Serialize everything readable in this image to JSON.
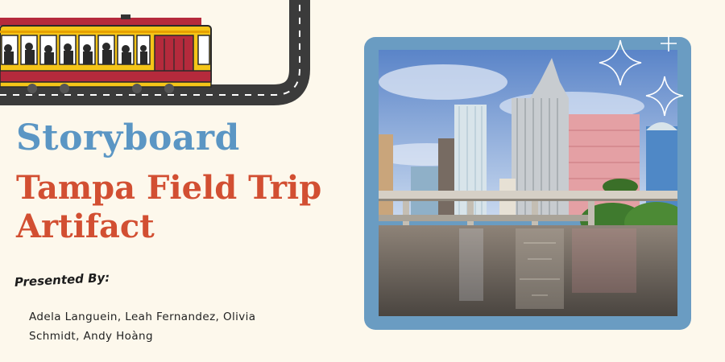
{
  "title_line1": "Storyboard",
  "title_line2": "Tampa Field Trip Artifact",
  "presented_label": "Presented By:",
  "authors": "Adela Languein, Leah Fernandez, Olivia Schmidt, Andy Hoàng",
  "colors": {
    "background": "#fdf8ec",
    "title_blue": "#5b96c4",
    "title_red": "#d24f32",
    "frame_blue": "#6a9cc2",
    "road": "#3b3b3b",
    "tram_yellow": "#f5c518",
    "tram_red": "#b52a3c"
  },
  "icons": [
    "streetcar-icon",
    "sparkle-icon",
    "skyline-photo"
  ]
}
